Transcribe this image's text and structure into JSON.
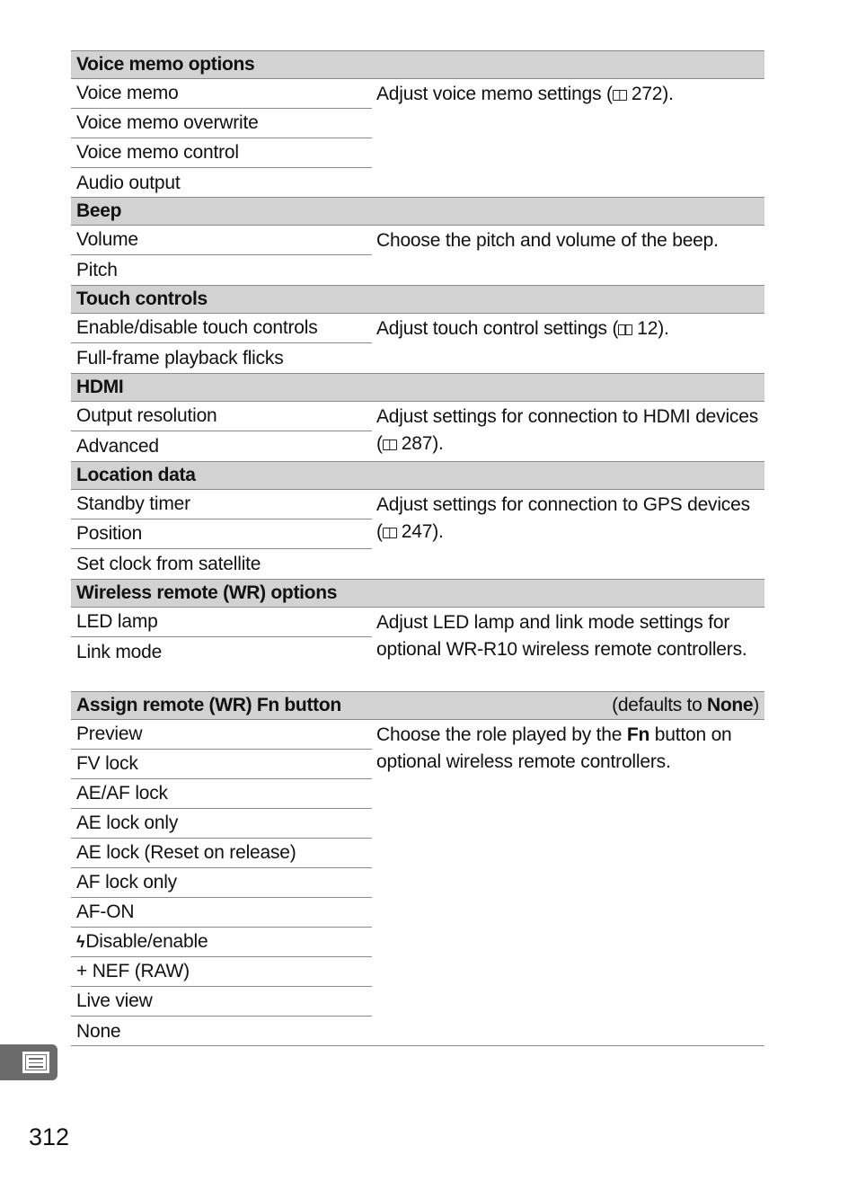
{
  "sections": [
    {
      "title": "Voice memo options",
      "note": null,
      "items": [
        "Voice memo",
        "Voice memo overwrite",
        "Voice memo control",
        "Audio output"
      ],
      "description": {
        "text": "Adjust voice memo settings (",
        "ref": "272",
        "after": ")."
      }
    },
    {
      "title": "Beep",
      "note": null,
      "items": [
        "Volume",
        "Pitch"
      ],
      "description": {
        "text": "Choose the pitch and volume of the beep.",
        "ref": null,
        "after": ""
      }
    },
    {
      "title": "Touch controls",
      "note": null,
      "items": [
        "Enable/disable touch controls",
        "Full-frame playback flicks"
      ],
      "description": {
        "text": "Adjust touch control settings (",
        "ref": "12",
        "after": ")."
      }
    },
    {
      "title": "HDMI",
      "note": null,
      "items": [
        "Output resolution",
        "Advanced"
      ],
      "description": {
        "text": "Adjust settings for connection to HDMI devices (",
        "ref": "287",
        "after": ")."
      }
    },
    {
      "title": "Location data",
      "note": null,
      "items": [
        "Standby timer",
        "Position",
        "Set clock from satellite"
      ],
      "description": {
        "text": "Adjust settings for connection to GPS devices (",
        "ref": "247",
        "after": ")."
      }
    },
    {
      "title": "Wireless remote (WR) options",
      "note": null,
      "items": [
        "LED lamp",
        "Link mode"
      ],
      "description": {
        "text": "Adjust LED lamp and link mode settings for optional WR-R10 wireless remote controllers.",
        "ref": null,
        "after": ""
      }
    },
    {
      "title": "Assign remote (WR) Fn button",
      "note": {
        "prefix": "(defaults to ",
        "value": "None",
        "suffix": ")"
      },
      "items": [
        "Preview",
        "FV lock",
        "AE/AF lock",
        "AE lock only",
        "AE lock (Reset on release)",
        "AF lock only",
        "AF-ON",
        "Disable/enable",
        "+ NEF (RAW)",
        "Live view",
        "None"
      ],
      "description": {
        "before": "Choose the role played by the ",
        "bold": "Fn",
        "after": " button on optional wireless remote controllers."
      }
    }
  ],
  "flash_icon": "flash-icon",
  "side_tab_icon": "menu-list-icon",
  "page_number": "312"
}
